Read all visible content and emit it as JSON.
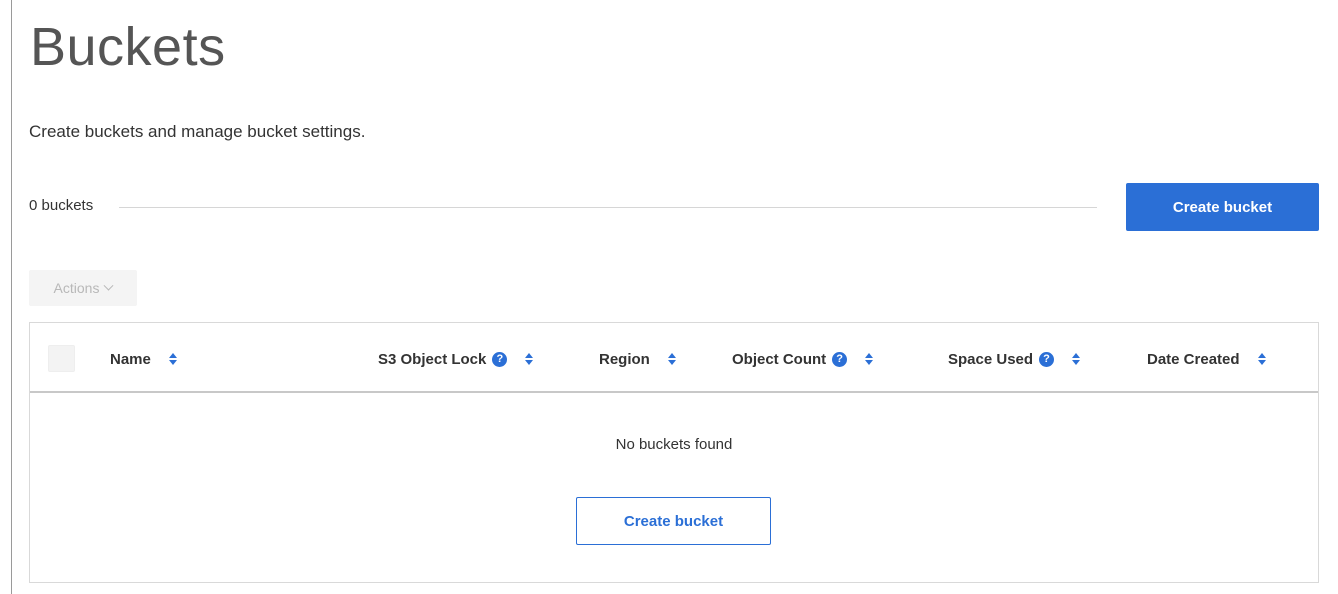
{
  "page": {
    "title": "Buckets",
    "description": "Create buckets and manage bucket settings."
  },
  "summary": {
    "count_text": "0 buckets",
    "create_label": "Create bucket"
  },
  "actions": {
    "label": "Actions",
    "disabled": true
  },
  "table": {
    "columns": [
      {
        "label": "Name",
        "help": false
      },
      {
        "label": "S3 Object Lock",
        "help": true
      },
      {
        "label": "Region",
        "help": false
      },
      {
        "label": "Object Count",
        "help": true
      },
      {
        "label": "Space Used",
        "help": true
      },
      {
        "label": "Date Created",
        "help": false
      }
    ],
    "empty_text": "No buckets found",
    "empty_create_label": "Create bucket"
  },
  "icons": {
    "help": "question-circle-icon",
    "sort": "sort-arrows-icon",
    "dropdown": "chevron-down-icon"
  },
  "colors": {
    "primary": "#2b6fd6",
    "disabled_bg": "#f4f4f4",
    "disabled_text": "#b8b8b8"
  }
}
